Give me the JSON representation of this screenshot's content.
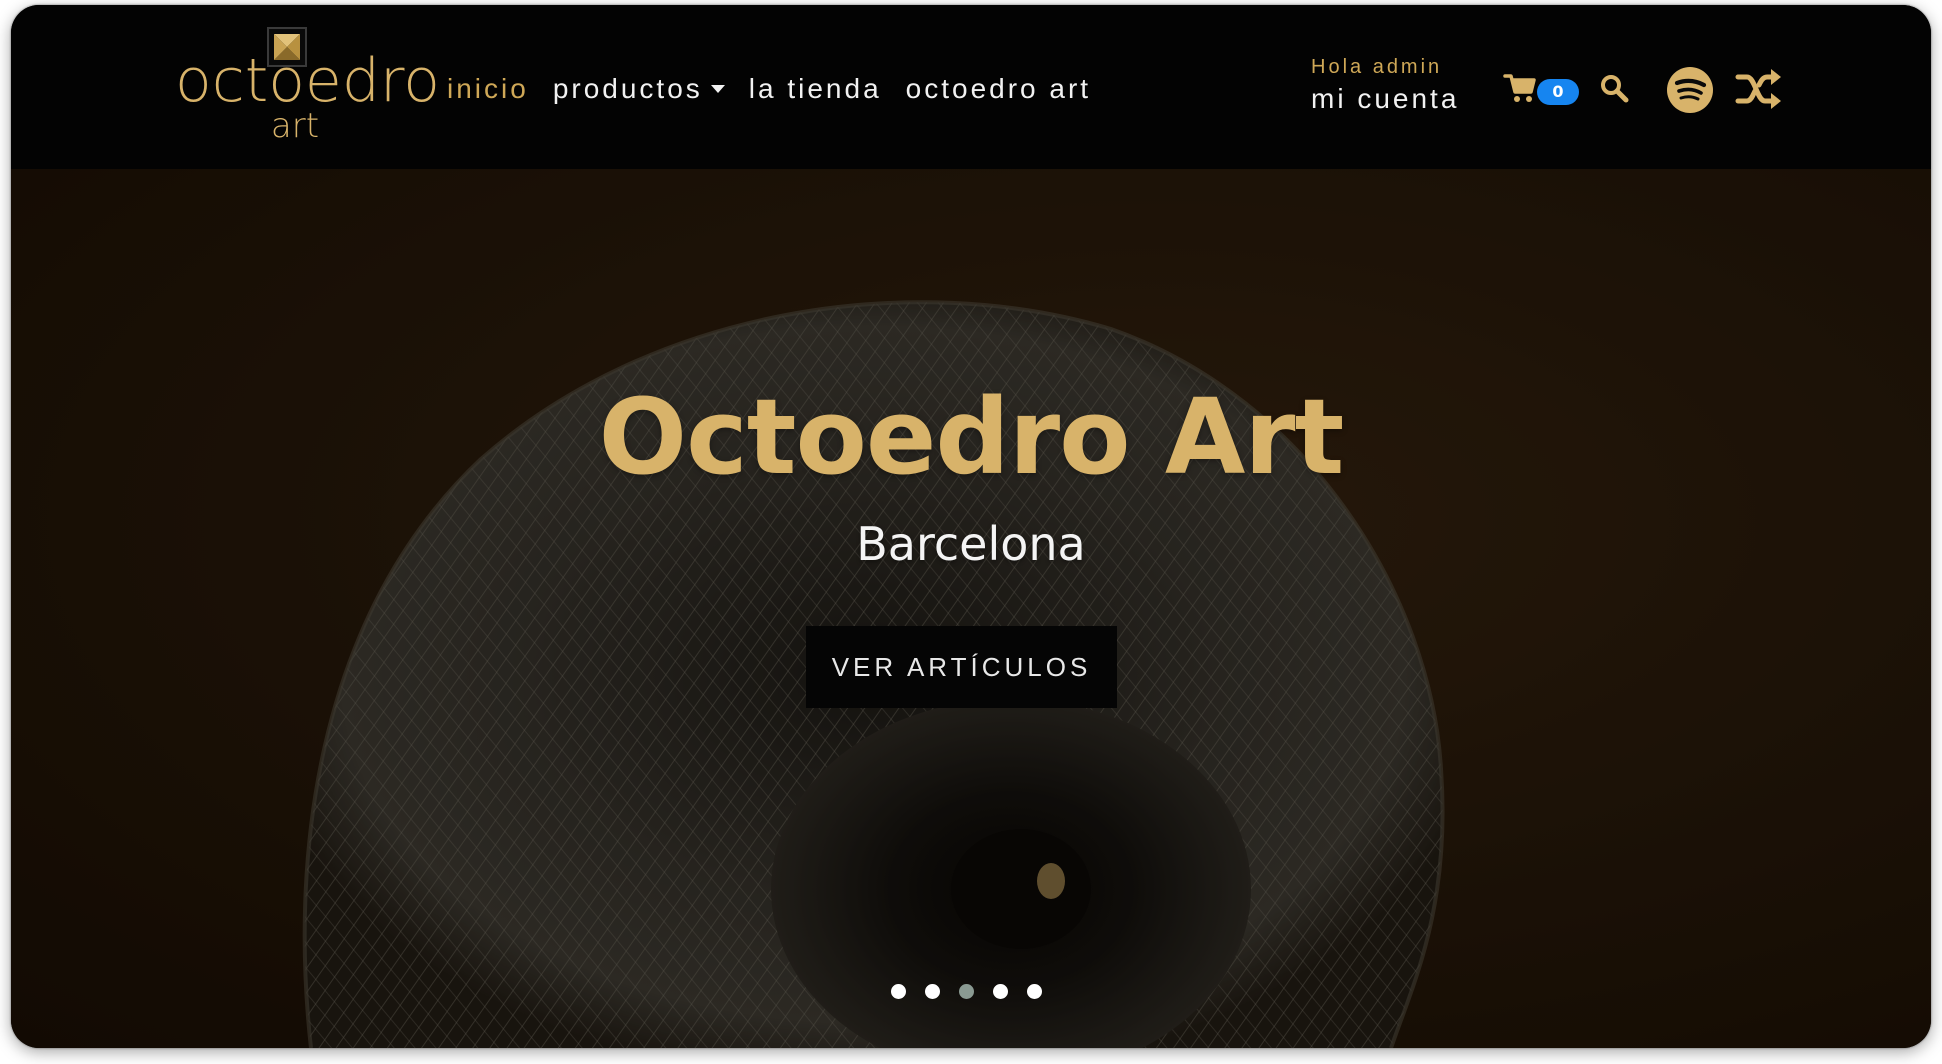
{
  "brand": {
    "wordmark": "octoedro",
    "sub": "art"
  },
  "nav": {
    "items": [
      {
        "label": "inicio",
        "active": true
      },
      {
        "label": "productos",
        "dropdown": true
      },
      {
        "label": "la tienda"
      },
      {
        "label": "octoedro art"
      }
    ]
  },
  "account": {
    "greeting": "Hola admin",
    "link_label": "mi cuenta"
  },
  "cart": {
    "count": "0",
    "icon": "shopping-cart-icon"
  },
  "icons": {
    "search": "search-icon",
    "spotify": "spotify-icon",
    "shuffle": "shuffle-icon"
  },
  "hero": {
    "title": "Octoedro Art",
    "subtitle": "Barcelona",
    "cta_label": "VER ARTÍCULOS",
    "slide_count": 5,
    "active_slide": 3
  },
  "colors": {
    "accent_gold": "#d8b36a",
    "nav_active": "#cfa857",
    "badge_blue": "#1685f0",
    "navbar_bg": "#030303"
  }
}
